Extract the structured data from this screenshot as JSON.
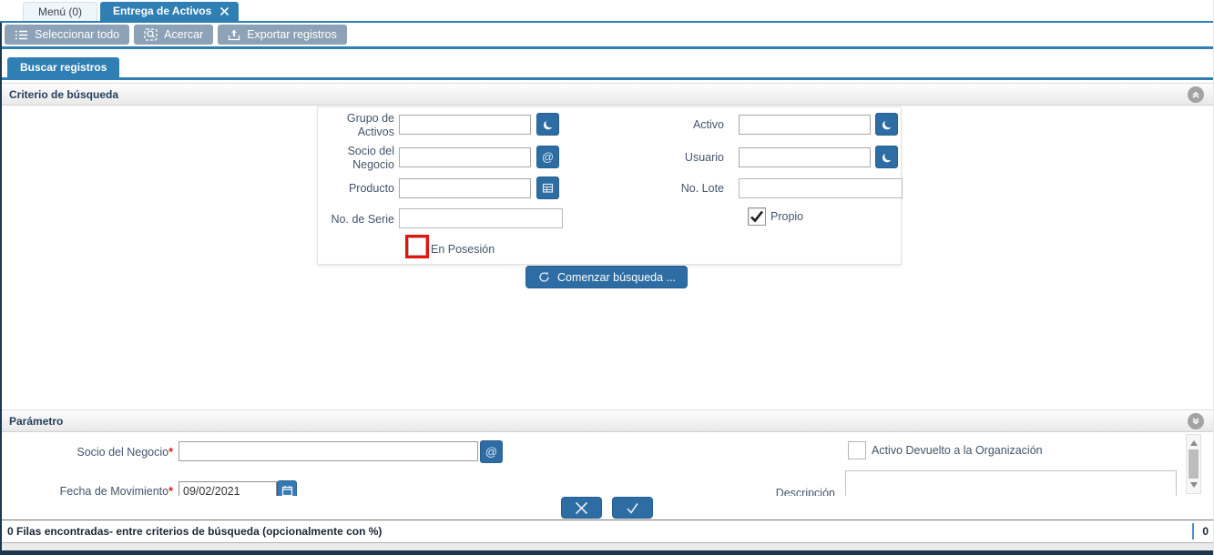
{
  "tabs": {
    "menu": "Menú (0)",
    "active": "Entrega de Activos"
  },
  "toolbar": {
    "select_all": "Seleccionar todo",
    "zoom": "Acercar",
    "export": "Exportar registros"
  },
  "subtab": "Buscar registros",
  "criteria": {
    "title": "Criterio de búsqueda",
    "asset_group_label": "Grupo de Activos",
    "bpartner_label": "Socio del Negocio",
    "product_label": "Producto",
    "serial_label": "No. de Serie",
    "asset_label": "Activo",
    "user_label": "Usuario",
    "lot_label": "No. Lote",
    "owned_label": "Propio",
    "possession_label": "En Posesión",
    "search_button": "Comenzar búsqueda ..."
  },
  "parameters": {
    "title": "Parámetro",
    "bpartner_label": "Socio del Negocio",
    "bpartner_required": "*",
    "date_label": "Fecha de Movimiento",
    "date_required": "*",
    "date_value": "09/02/2021",
    "returned_label": "Activo Devuelto a la Organización",
    "description_label": "Descripción"
  },
  "statusbar": {
    "message": "0 Filas encontradas- entre criterios de búsqueda (opcionalmente con %)",
    "count": "0"
  },
  "state": {
    "owned_checked": true,
    "possession_checked": false,
    "returned_checked": false,
    "possession_highlighted": true
  },
  "colors": {
    "accent_blue": "#2f7fb4",
    "button_blue": "#2e6da4",
    "toolbar_button": "#8da2b7",
    "highlight_red": "#e8120c",
    "dark_edge": "#1d3750"
  }
}
